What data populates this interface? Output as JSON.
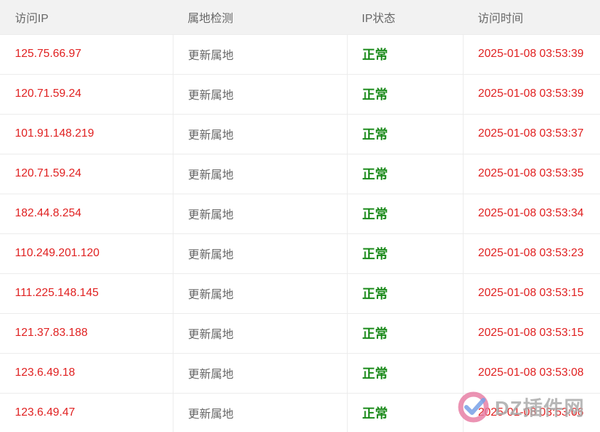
{
  "headers": {
    "ip": "访问IP",
    "location": "属地检测",
    "status": "IP状态",
    "time": "访问时间"
  },
  "rows": [
    {
      "ip": "125.75.66.97",
      "location": "更新属地",
      "status": "正常",
      "time": "2025-01-08 03:53:39"
    },
    {
      "ip": "120.71.59.24",
      "location": "更新属地",
      "status": "正常",
      "time": "2025-01-08 03:53:39"
    },
    {
      "ip": "101.91.148.219",
      "location": "更新属地",
      "status": "正常",
      "time": "2025-01-08 03:53:37"
    },
    {
      "ip": "120.71.59.24",
      "location": "更新属地",
      "status": "正常",
      "time": "2025-01-08 03:53:35"
    },
    {
      "ip": "182.44.8.254",
      "location": "更新属地",
      "status": "正常",
      "time": "2025-01-08 03:53:34"
    },
    {
      "ip": "110.249.201.120",
      "location": "更新属地",
      "status": "正常",
      "time": "2025-01-08 03:53:23"
    },
    {
      "ip": "111.225.148.145",
      "location": "更新属地",
      "status": "正常",
      "time": "2025-01-08 03:53:15"
    },
    {
      "ip": "121.37.83.188",
      "location": "更新属地",
      "status": "正常",
      "time": "2025-01-08 03:53:15"
    },
    {
      "ip": "123.6.49.18",
      "location": "更新属地",
      "status": "正常",
      "time": "2025-01-08 03:53:08"
    },
    {
      "ip": "123.6.49.47",
      "location": "更新属地",
      "status": "正常",
      "time": "2025-01-08 03:53:06"
    }
  ],
  "colors": {
    "ip_text": "#e02020",
    "status_ok": "#1a8a1a",
    "header_bg": "#f2f2f2"
  },
  "watermark": {
    "text": "DZ插件网",
    "icon": "dz-logo-icon"
  }
}
